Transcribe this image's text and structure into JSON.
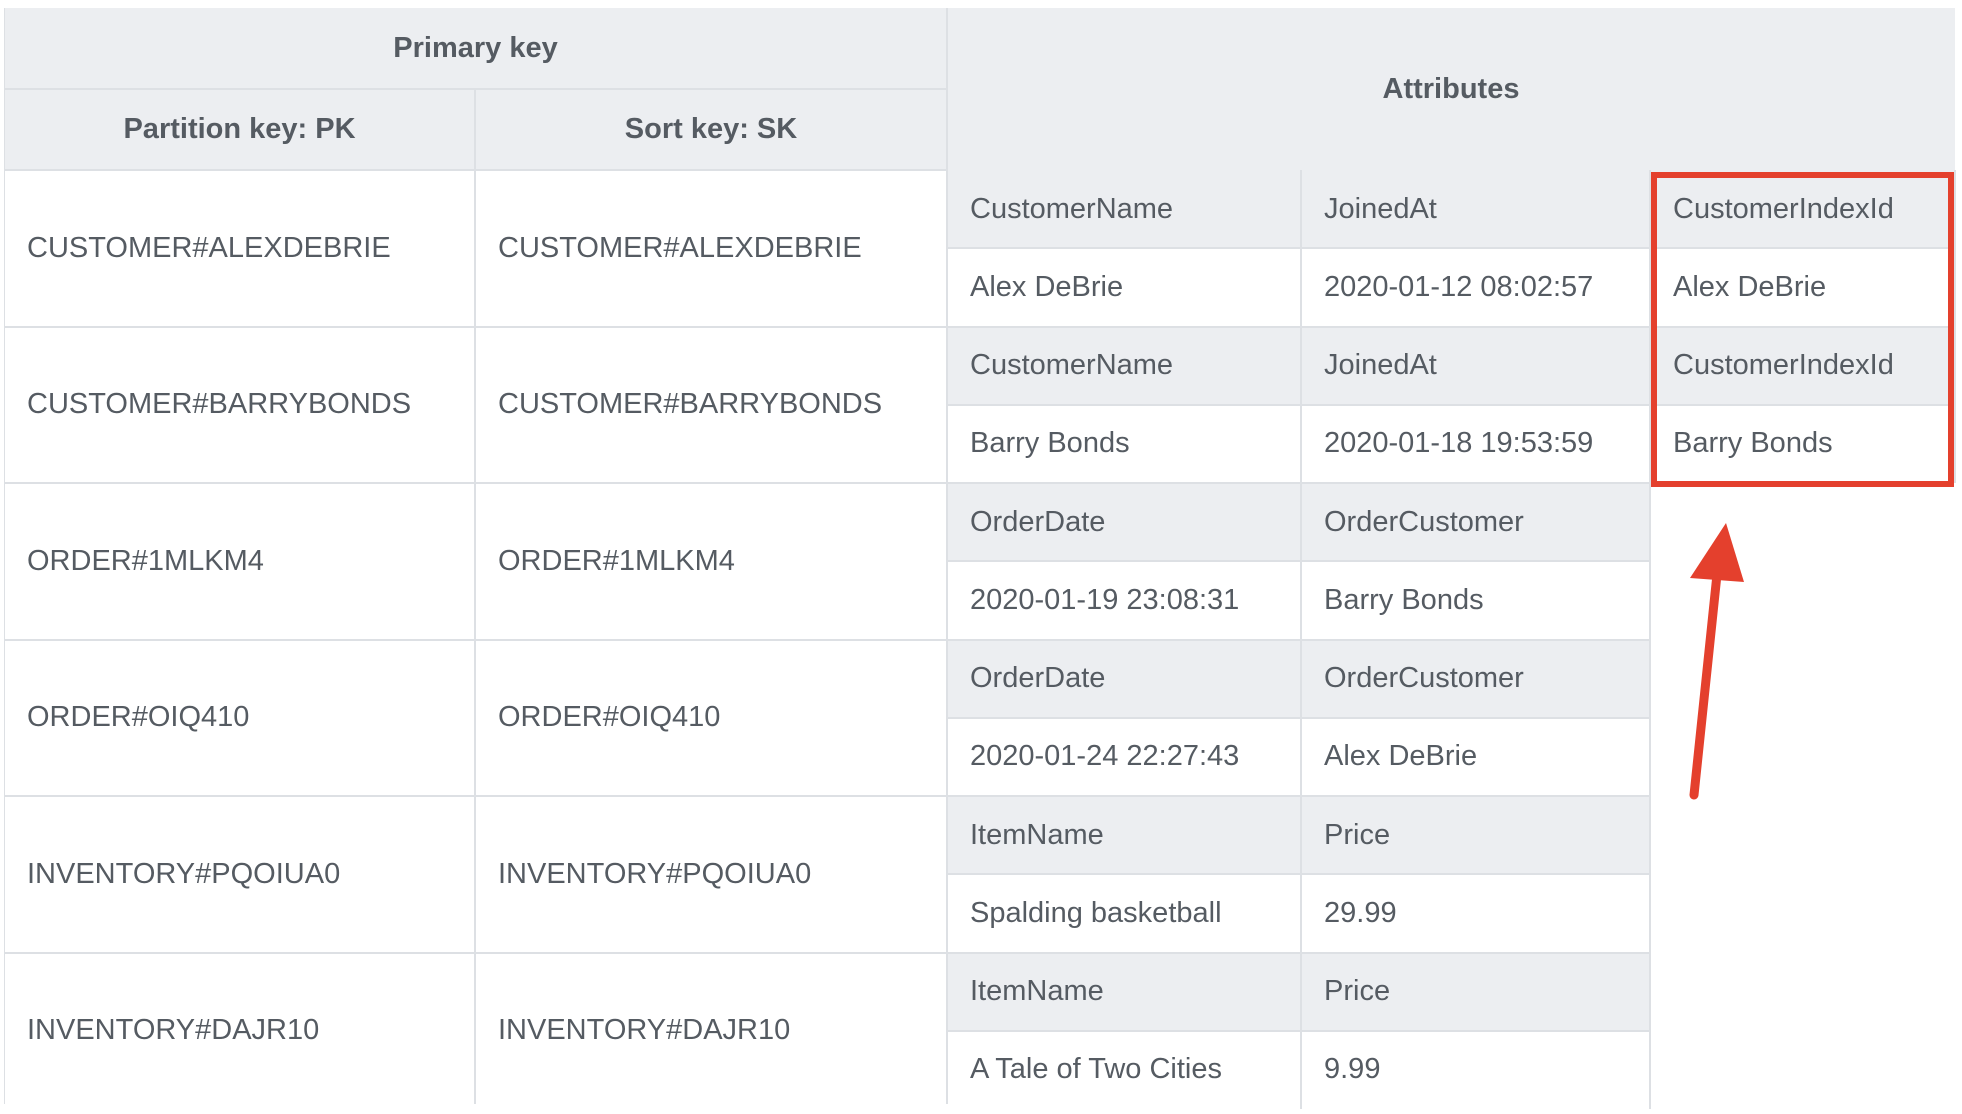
{
  "header": {
    "primary_key": "Primary key",
    "partition_key": "Partition key: PK",
    "sort_key": "Sort key: SK",
    "attributes": "Attributes"
  },
  "rows": [
    {
      "pk": "CUSTOMER#ALEXDEBRIE",
      "sk": "CUSTOMER#ALEXDEBRIE",
      "attributes": [
        {
          "name": "CustomerName",
          "value": "Alex DeBrie"
        },
        {
          "name": "JoinedAt",
          "value": "2020-01-12 08:02:57"
        },
        {
          "name": "CustomerIndexId",
          "value": "Alex DeBrie"
        }
      ]
    },
    {
      "pk": "CUSTOMER#BARRYBONDS",
      "sk": "CUSTOMER#BARRYBONDS",
      "attributes": [
        {
          "name": "CustomerName",
          "value": "Barry Bonds"
        },
        {
          "name": "JoinedAt",
          "value": "2020-01-18 19:53:59"
        },
        {
          "name": "CustomerIndexId",
          "value": "Barry Bonds"
        }
      ]
    },
    {
      "pk": "ORDER#1MLKM4",
      "sk": "ORDER#1MLKM4",
      "attributes": [
        {
          "name": "OrderDate",
          "value": "2020-01-19 23:08:31"
        },
        {
          "name": "OrderCustomer",
          "value": "Barry Bonds"
        }
      ]
    },
    {
      "pk": "ORDER#OIQ410",
      "sk": "ORDER#OIQ410",
      "attributes": [
        {
          "name": "OrderDate",
          "value": "2020-01-24 22:27:43"
        },
        {
          "name": "OrderCustomer",
          "value": "Alex DeBrie"
        }
      ]
    },
    {
      "pk": "INVENTORY#PQOIUA0",
      "sk": "INVENTORY#PQOIUA0",
      "attributes": [
        {
          "name": "ItemName",
          "value": "Spalding basketball"
        },
        {
          "name": "Price",
          "value": "29.99"
        }
      ]
    },
    {
      "pk": "INVENTORY#DAJR10",
      "sk": "INVENTORY#DAJR10",
      "attributes": [
        {
          "name": "ItemName",
          "value": "A Tale of Two Cities"
        },
        {
          "name": "Price",
          "value": "9.99"
        }
      ]
    }
  ],
  "annotation": {
    "highlight_color": "#e4402d",
    "highlighted_attribute": "CustomerIndexId"
  }
}
